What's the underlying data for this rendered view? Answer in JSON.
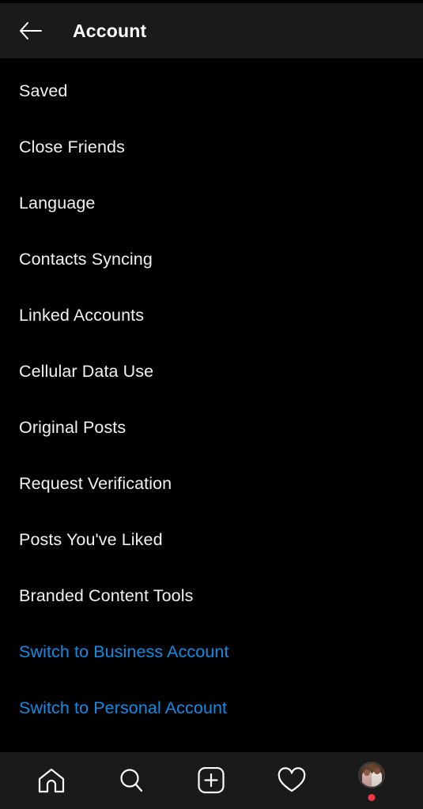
{
  "header": {
    "title": "Account",
    "back_icon": "arrow-left-icon"
  },
  "colors": {
    "background": "#000000",
    "bar_background": "#1a1a1a",
    "text": "#f2f2f2",
    "link": "#0f8ce8",
    "notification_dot": "#f0374a"
  },
  "menu": {
    "items": [
      {
        "label": "Saved",
        "type": "normal"
      },
      {
        "label": "Close Friends",
        "type": "normal"
      },
      {
        "label": "Language",
        "type": "normal"
      },
      {
        "label": "Contacts Syncing",
        "type": "normal"
      },
      {
        "label": "Linked Accounts",
        "type": "normal"
      },
      {
        "label": "Cellular Data Use",
        "type": "normal"
      },
      {
        "label": "Original Posts",
        "type": "normal"
      },
      {
        "label": "Request Verification",
        "type": "normal"
      },
      {
        "label": "Posts You've Liked",
        "type": "normal"
      },
      {
        "label": "Branded Content Tools",
        "type": "normal"
      },
      {
        "label": "Switch to Business Account",
        "type": "link"
      },
      {
        "label": "Switch to Personal Account",
        "type": "link"
      }
    ]
  },
  "bottom_nav": {
    "items": [
      {
        "name": "home-icon"
      },
      {
        "name": "search-icon"
      },
      {
        "name": "add-post-icon"
      },
      {
        "name": "activity-heart-icon"
      },
      {
        "name": "profile-avatar"
      }
    ]
  }
}
